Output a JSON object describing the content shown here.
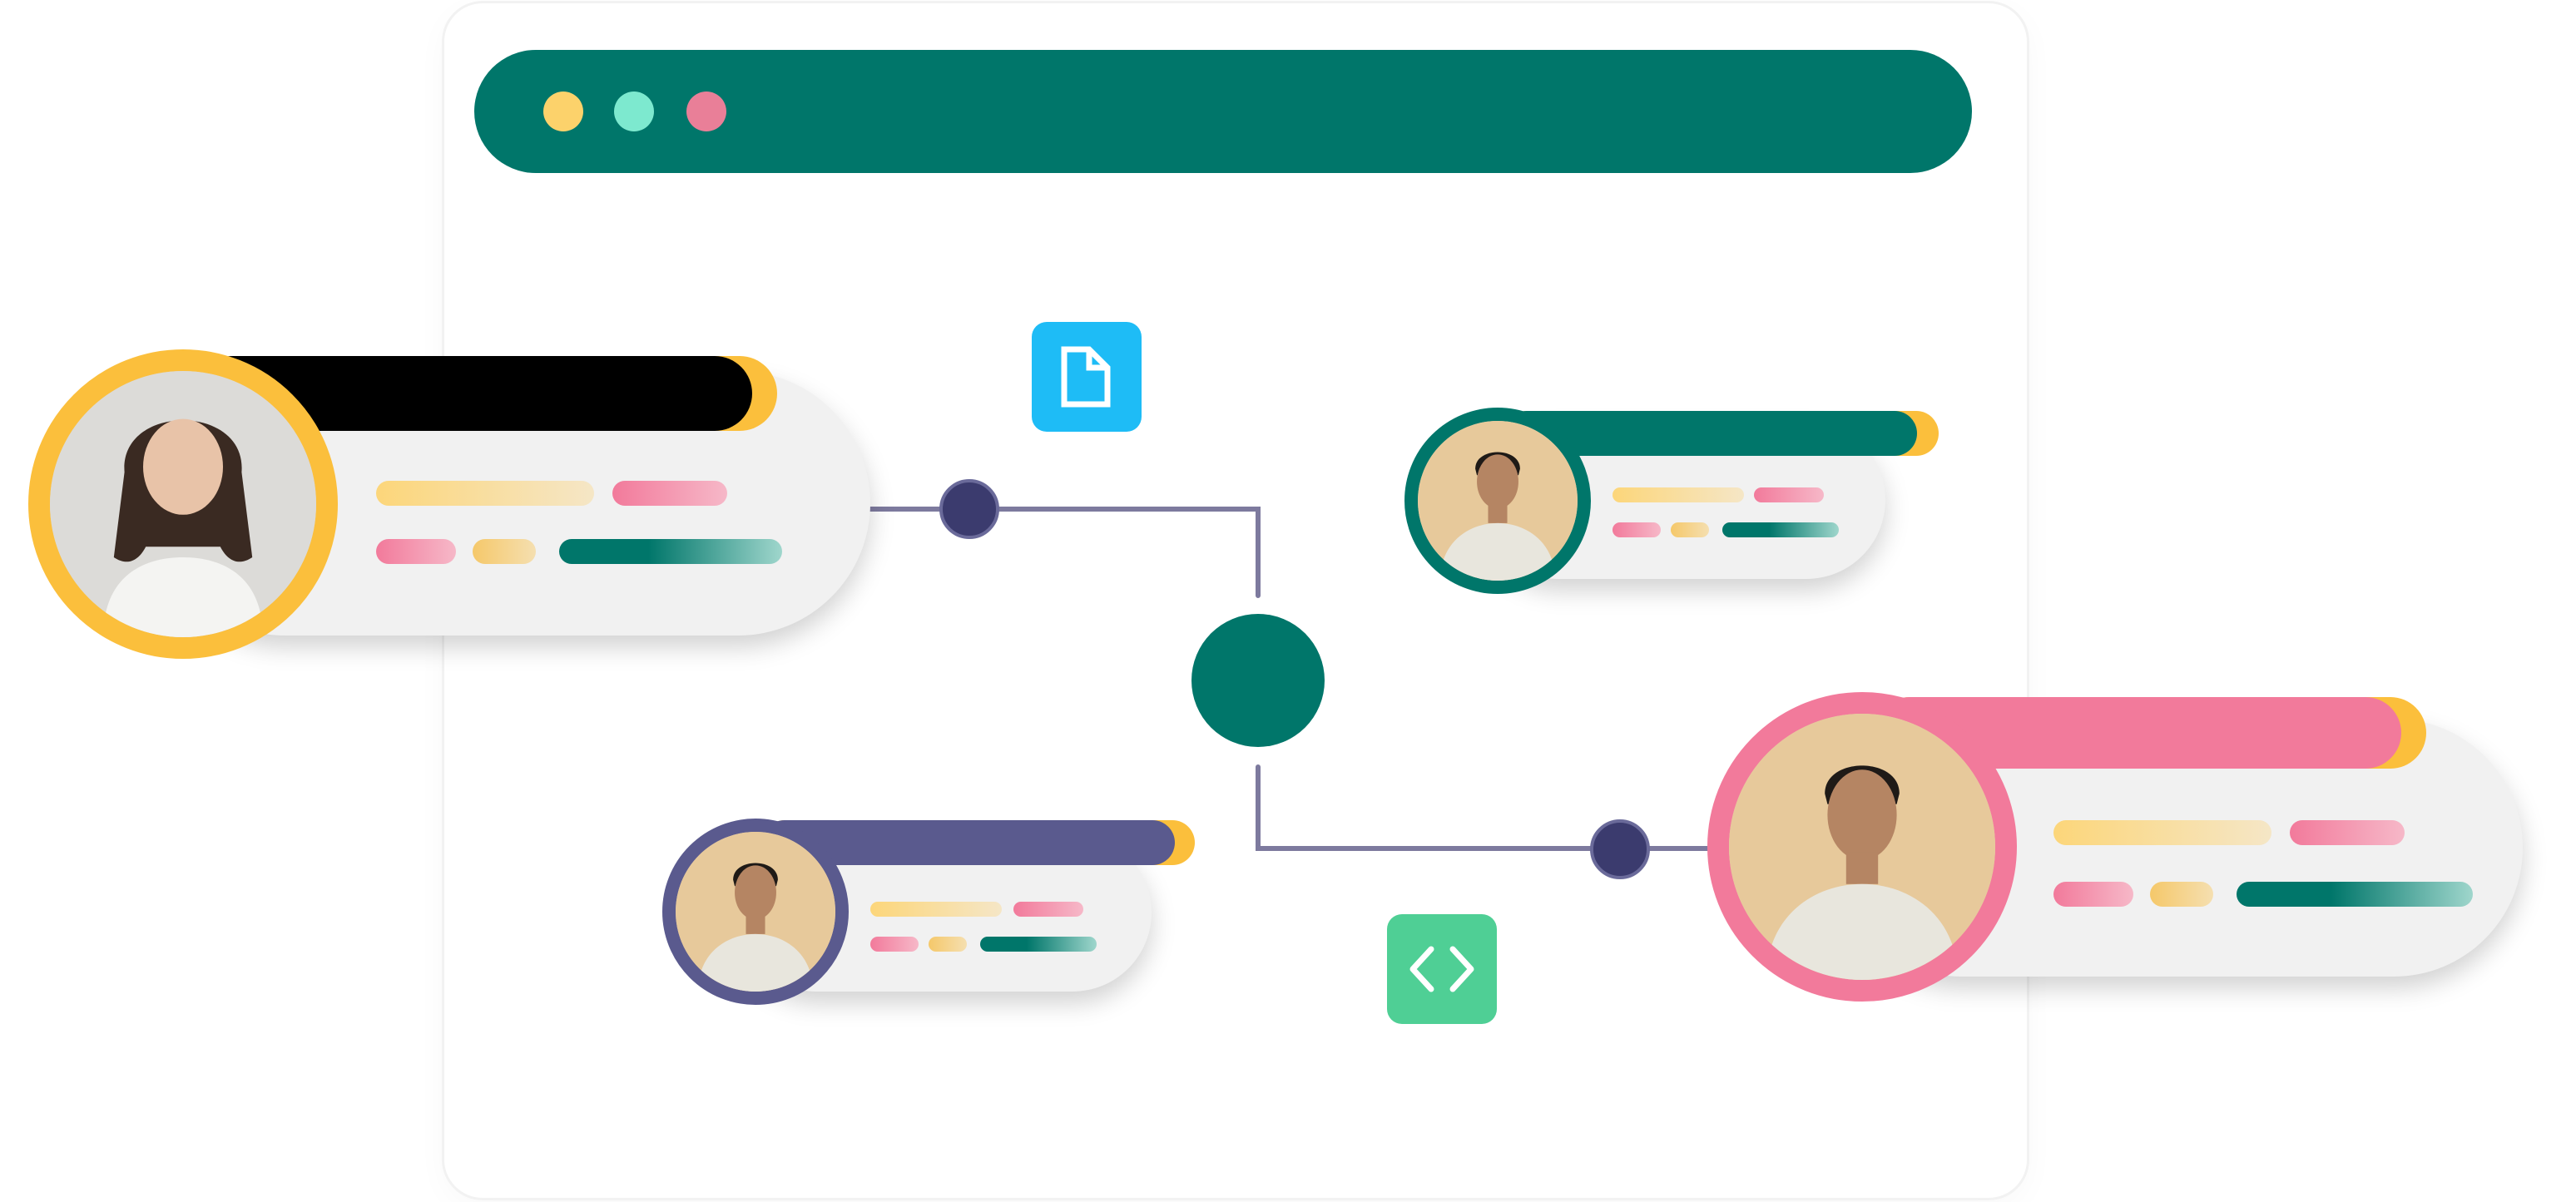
{
  "colors": {
    "window_bar": "#00766a",
    "dot_yellow": "#fcd26b",
    "dot_mint": "#7de9cf",
    "dot_pink": "#e97f98",
    "hub": "#00766a",
    "node": "#3b3b6e",
    "connector": "#7d7a9e",
    "accent_yellow": "#fbbf3c",
    "accent_pink": "#f27a9b",
    "accent_purple": "#5a5a8e",
    "accent_black": "#000000",
    "doc_tile": "#1ebcf6",
    "code_tile": "#4fcf95"
  },
  "icons": {
    "document": "document-icon",
    "code": "code-brackets-icon"
  },
  "profiles": [
    {
      "id": "profile-1",
      "ring": "yellow",
      "tab": "black",
      "avatar": "woman-long-hair"
    },
    {
      "id": "profile-2",
      "ring": "teal",
      "tab": "teal",
      "avatar": "man-portrait"
    },
    {
      "id": "profile-3",
      "ring": "purple",
      "tab": "purple",
      "avatar": "man-portrait"
    },
    {
      "id": "profile-4",
      "ring": "pink",
      "tab": "pink",
      "avatar": "man-portrait"
    }
  ]
}
